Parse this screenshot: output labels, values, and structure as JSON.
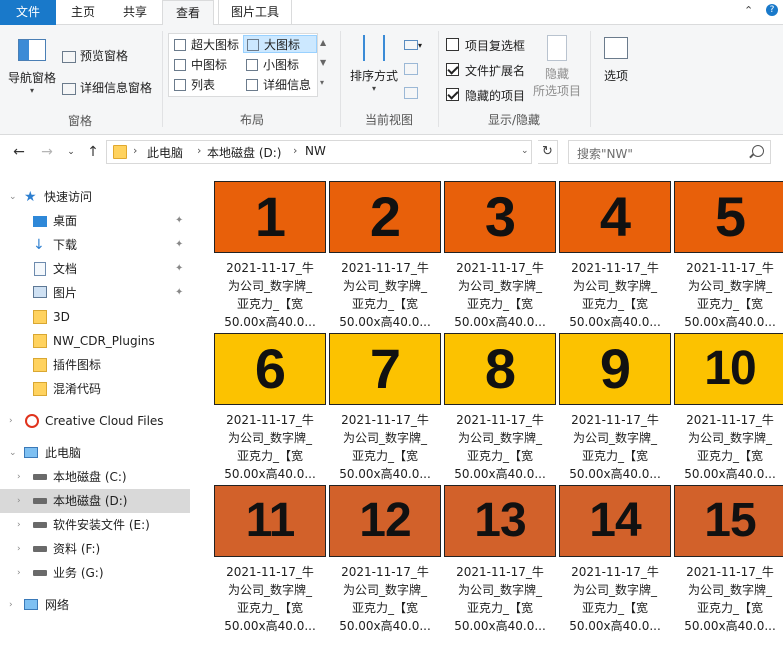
{
  "tabs": {
    "file": "文件",
    "home": "主页",
    "share": "共享",
    "view": "查看",
    "picture_tools": "图片工具",
    "help": "?"
  },
  "ribbon": {
    "pane": {
      "nav_pane": "导航窗格",
      "preview_pane": "预览窗格",
      "details_pane": "详细信息窗格",
      "label": "窗格"
    },
    "layout": {
      "extra_large": "超大图标",
      "large": "大图标",
      "medium": "中图标",
      "small": "小图标",
      "list": "列表",
      "details": "详细信息",
      "label": "布局"
    },
    "current_view": {
      "sort_by": "排序方式",
      "label": "当前视图"
    },
    "show_hide": {
      "item_checkboxes": "项目复选框",
      "file_extensions": "文件扩展名",
      "hidden_items": "隐藏的项目",
      "hide_selected_1": "隐藏",
      "hide_selected_2": "所选项目",
      "label": "显示/隐藏",
      "item_checkboxes_checked": false,
      "file_extensions_checked": true,
      "hidden_items_checked": true
    },
    "options": "选项"
  },
  "address": {
    "crumbs": [
      "此电脑",
      "本地磁盘 (D:)",
      "NW"
    ],
    "search_placeholder": "搜索\"NW\""
  },
  "sidebar": {
    "quick_access": "快速访问",
    "desktop": "桌面",
    "downloads": "下载",
    "documents": "文档",
    "pictures": "图片",
    "f3d": "3D",
    "nw_cdr": "NW_CDR_Plugins",
    "plugin_icons": "插件图标",
    "obfuscate": "混淆代码",
    "creative_cloud": "Creative Cloud Files",
    "this_pc": "此电脑",
    "drive_c": "本地磁盘 (C:)",
    "drive_d": "本地磁盘 (D:)",
    "drive_e": "软件安装文件 (E:)",
    "drive_f": "资料 (F:)",
    "drive_g": "业务 (G:)",
    "network": "网络"
  },
  "files": [
    {
      "number": "1",
      "color": "#e8600a",
      "cap1": "2021-11-17_牛",
      "cap2": "为公司_数字牌_",
      "cap3": "亚克力_【宽",
      "cap4": "50.00x高40.0..."
    },
    {
      "number": "2",
      "color": "#e8600a",
      "cap1": "2021-11-17_牛",
      "cap2": "为公司_数字牌_",
      "cap3": "亚克力_【宽",
      "cap4": "50.00x高40.0..."
    },
    {
      "number": "3",
      "color": "#e8600a",
      "cap1": "2021-11-17_牛",
      "cap2": "为公司_数字牌_",
      "cap3": "亚克力_【宽",
      "cap4": "50.00x高40.0..."
    },
    {
      "number": "4",
      "color": "#e8600a",
      "cap1": "2021-11-17_牛",
      "cap2": "为公司_数字牌_",
      "cap3": "亚克力_【宽",
      "cap4": "50.00x高40.0..."
    },
    {
      "number": "5",
      "color": "#e8600a",
      "cap1": "2021-11-17_牛",
      "cap2": "为公司_数字牌_",
      "cap3": "亚克力_【宽",
      "cap4": "50.00x高40.0..."
    },
    {
      "number": "6",
      "color": "#fcc200",
      "cap1": "2021-11-17_牛",
      "cap2": "为公司_数字牌_",
      "cap3": "亚克力_【宽",
      "cap4": "50.00x高40.0..."
    },
    {
      "number": "7",
      "color": "#fcc200",
      "cap1": "2021-11-17_牛",
      "cap2": "为公司_数字牌_",
      "cap3": "亚克力_【宽",
      "cap4": "50.00x高40.0..."
    },
    {
      "number": "8",
      "color": "#fcc200",
      "cap1": "2021-11-17_牛",
      "cap2": "为公司_数字牌_",
      "cap3": "亚克力_【宽",
      "cap4": "50.00x高40.0..."
    },
    {
      "number": "9",
      "color": "#fcc200",
      "cap1": "2021-11-17_牛",
      "cap2": "为公司_数字牌_",
      "cap3": "亚克力_【宽",
      "cap4": "50.00x高40.0..."
    },
    {
      "number": "10",
      "color": "#fcc200",
      "cap1": "2021-11-17_牛",
      "cap2": "为公司_数字牌_",
      "cap3": "亚克力_【宽",
      "cap4": "50.00x高40.0..."
    },
    {
      "number": "11",
      "color": "#d2612a",
      "cap1": "2021-11-17_牛",
      "cap2": "为公司_数字牌_",
      "cap3": "亚克力_【宽",
      "cap4": "50.00x高40.0..."
    },
    {
      "number": "12",
      "color": "#d2612a",
      "cap1": "2021-11-17_牛",
      "cap2": "为公司_数字牌_",
      "cap3": "亚克力_【宽",
      "cap4": "50.00x高40.0..."
    },
    {
      "number": "13",
      "color": "#d2612a",
      "cap1": "2021-11-17_牛",
      "cap2": "为公司_数字牌_",
      "cap3": "亚克力_【宽",
      "cap4": "50.00x高40.0..."
    },
    {
      "number": "14",
      "color": "#d2612a",
      "cap1": "2021-11-17_牛",
      "cap2": "为公司_数字牌_",
      "cap3": "亚克力_【宽",
      "cap4": "50.00x高40.0..."
    },
    {
      "number": "15",
      "color": "#d2612a",
      "cap1": "2021-11-17_牛",
      "cap2": "为公司_数字牌_",
      "cap3": "亚克力_【宽",
      "cap4": "50.00x高40.0..."
    }
  ]
}
